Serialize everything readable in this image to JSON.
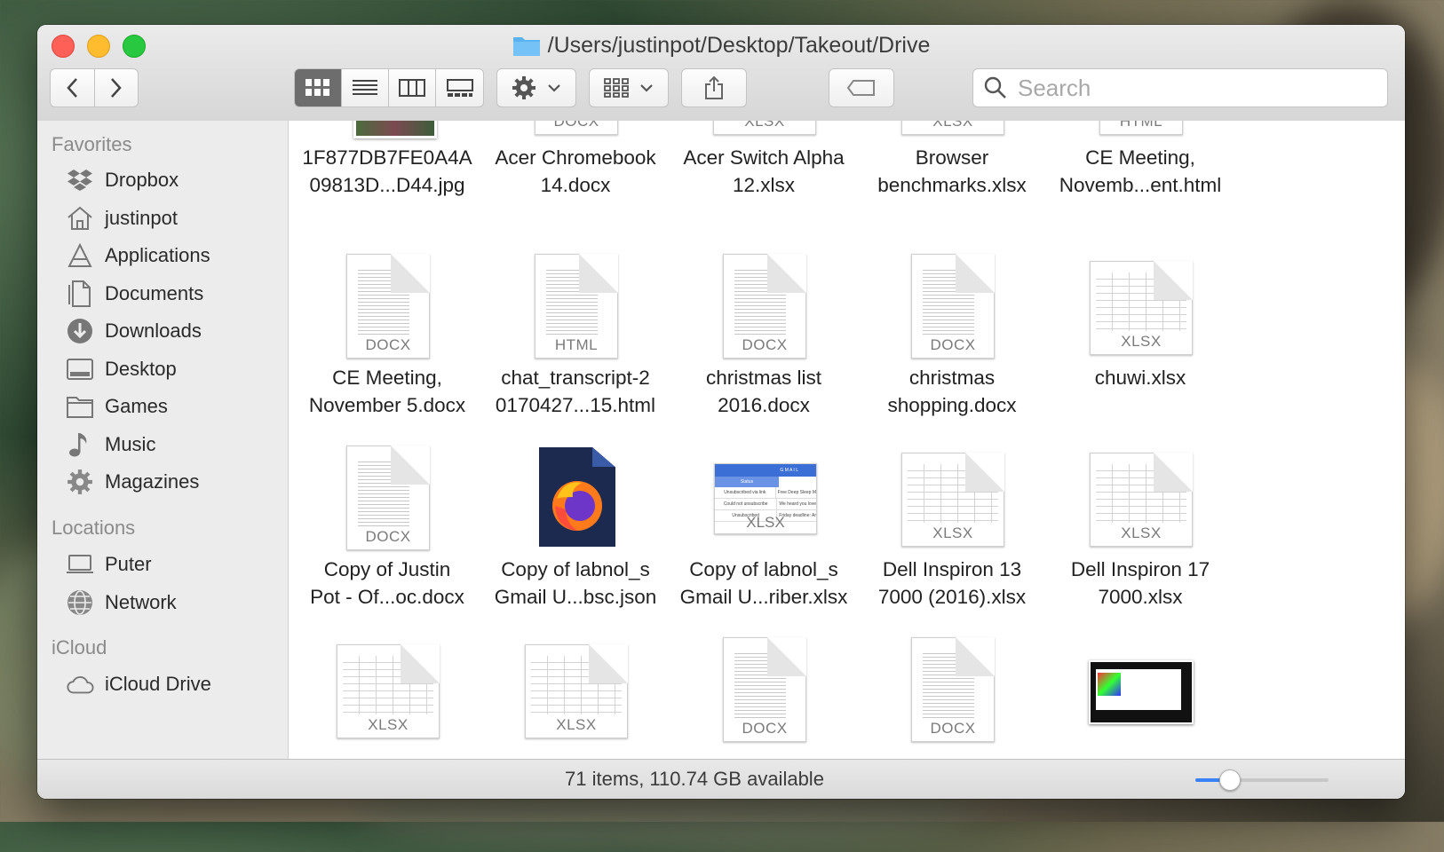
{
  "window": {
    "title": "/Users/justinpot/Desktop/Takeout/Drive"
  },
  "search": {
    "placeholder": "Search"
  },
  "sidebar": {
    "favorites_heading": "Favorites",
    "favorites": [
      {
        "label": "Dropbox",
        "icon": "dropbox-icon"
      },
      {
        "label": "justinpot",
        "icon": "home-icon"
      },
      {
        "label": "Applications",
        "icon": "applications-icon"
      },
      {
        "label": "Documents",
        "icon": "documents-icon"
      },
      {
        "label": "Downloads",
        "icon": "downloads-icon"
      },
      {
        "label": "Desktop",
        "icon": "desktop-icon"
      },
      {
        "label": "Games",
        "icon": "folder-icon"
      },
      {
        "label": "Music",
        "icon": "music-icon"
      },
      {
        "label": "Magazines",
        "icon": "gear-icon"
      }
    ],
    "locations_heading": "Locations",
    "locations": [
      {
        "label": "Puter",
        "icon": "laptop-icon"
      },
      {
        "label": "Network",
        "icon": "network-icon"
      }
    ],
    "icloud_heading": "iCloud",
    "icloud": [
      {
        "label": "iCloud Drive",
        "icon": "cloud-icon"
      }
    ]
  },
  "files": {
    "row0": [
      {
        "line1": "1F877DB7FE0A4A",
        "line2": "09813D...D44.jpg",
        "ext": ""
      },
      {
        "line1": "Acer Chromebook",
        "line2": "14.docx",
        "ext": "DOCX"
      },
      {
        "line1": "Acer Switch Alpha",
        "line2": "12.xlsx",
        "ext": "XLSX"
      },
      {
        "line1": "Browser",
        "line2": "benchmarks.xlsx",
        "ext": "XLSX"
      },
      {
        "line1": "CE Meeting,",
        "line2": "Novemb...ent.html",
        "ext": "HTML"
      }
    ],
    "row1": [
      {
        "line1": "CE Meeting,",
        "line2": "November 5.docx",
        "ext": "DOCX"
      },
      {
        "line1": "chat_transcript-2",
        "line2": "0170427...15.html",
        "ext": "HTML"
      },
      {
        "line1": "christmas list",
        "line2": "2016.docx",
        "ext": "DOCX"
      },
      {
        "line1": "christmas",
        "line2": "shopping.docx",
        "ext": "DOCX"
      },
      {
        "line1": "chuwi.xlsx",
        "line2": "",
        "ext": "XLSX"
      }
    ],
    "row2": [
      {
        "line1": "Copy of Justin",
        "line2": "Pot - Of...oc.docx",
        "ext": "DOCX"
      },
      {
        "line1": "Copy of labnol_s",
        "line2": "Gmail U...bsc.json",
        "ext": ""
      },
      {
        "line1": "Copy of labnol_s",
        "line2": "Gmail U...riber.xlsx",
        "ext": "XLSX"
      },
      {
        "line1": "Dell Inspiron 13",
        "line2": "7000 (2016).xlsx",
        "ext": "XLSX"
      },
      {
        "line1": "Dell Inspiron 17",
        "line2": "7000.xlsx",
        "ext": "XLSX"
      }
    ],
    "row3": [
      {
        "ext": "XLSX"
      },
      {
        "ext": "XLSX"
      },
      {
        "ext": "DOCX"
      },
      {
        "ext": "DOCX"
      },
      {
        "ext": ""
      }
    ],
    "gmail_preview": {
      "header": "G M A I L",
      "tab": "Status",
      "rows": [
        "Unsubscribed via link",
        "Could not unsubscribe",
        "Unsubscribed"
      ],
      "col2": [
        "Free Deep Sleep M",
        "We heard you love",
        "Friday deadline: Ar"
      ]
    }
  },
  "status": {
    "text": "71 items, 110.74 GB available",
    "zoom_fraction": 0.25
  },
  "colors": {
    "accent": "#3b82f6",
    "close": "#fe5f57",
    "minimize": "#febc2e",
    "maximize": "#28c840"
  }
}
